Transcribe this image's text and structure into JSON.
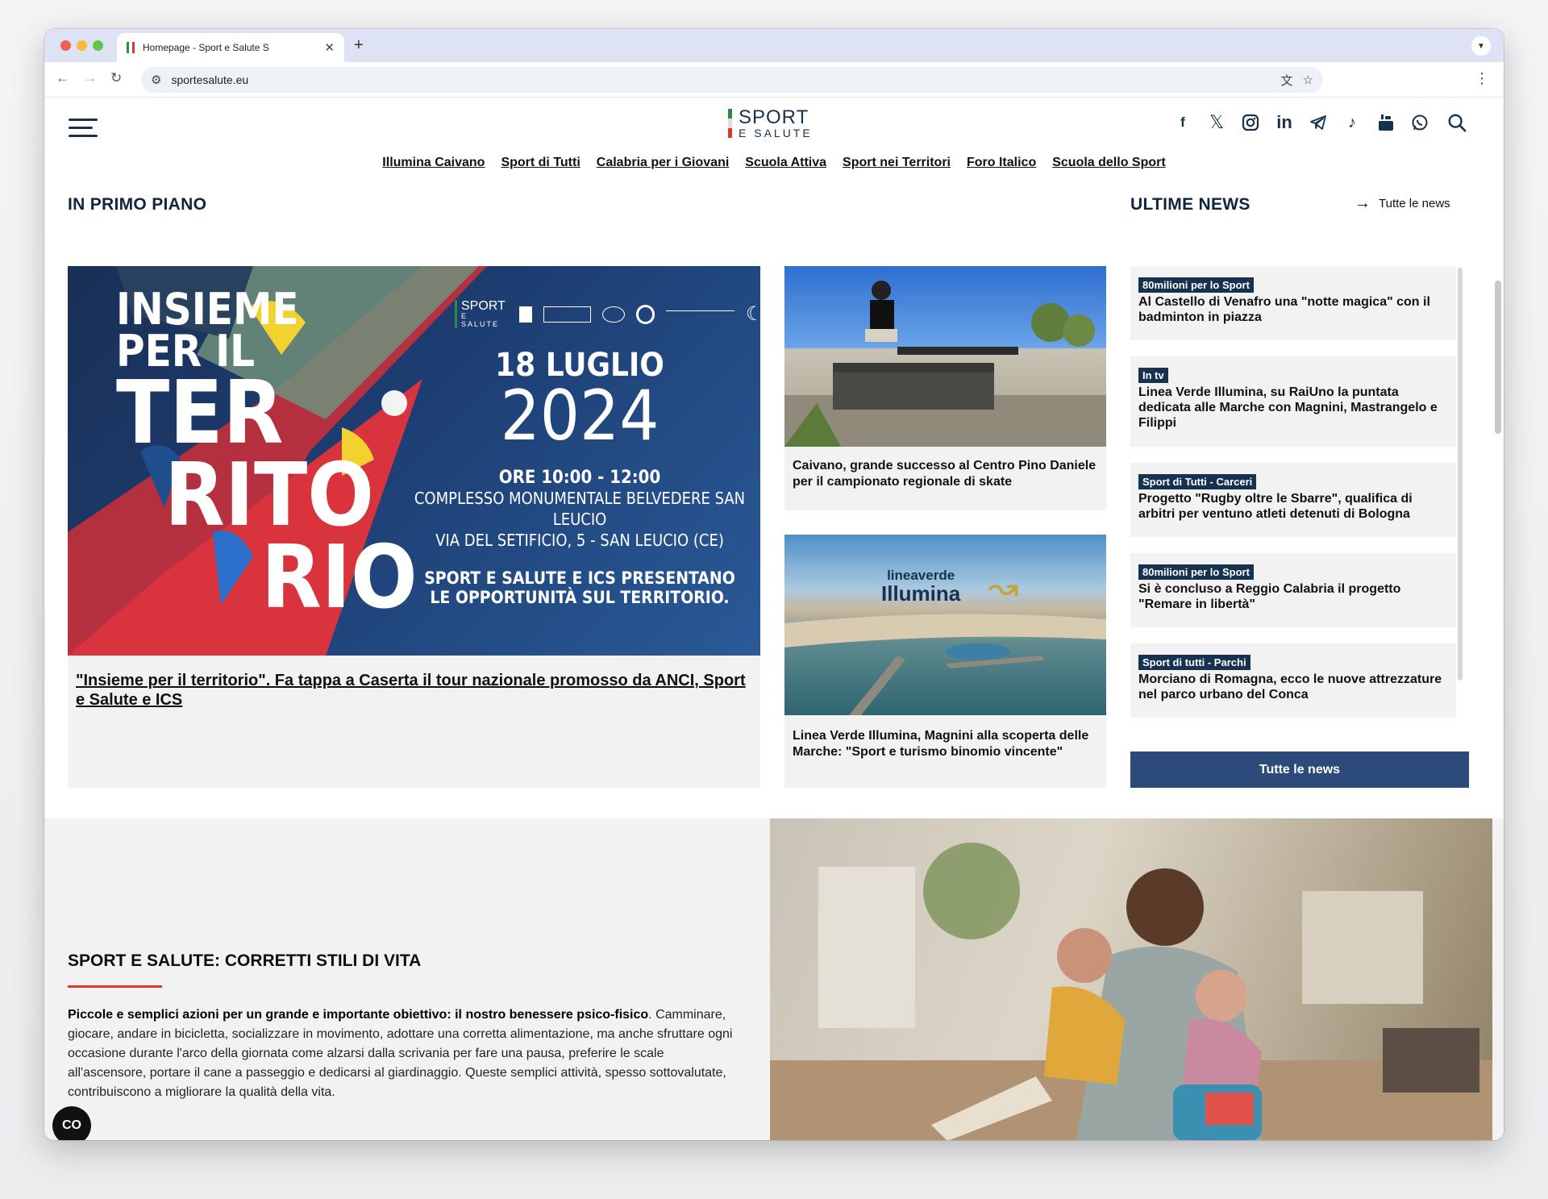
{
  "browser": {
    "tab_title": "Homepage - Sport e Salute S",
    "url": "sportesalute.eu"
  },
  "site": {
    "logo_line1": "SPORT",
    "logo_line2": "E SALUTE",
    "nav": [
      "Illumina Caivano",
      "Sport di Tutti",
      "Calabria per i Giovani",
      "Scuola Attiva",
      "Sport nei Territori",
      "Foro Italico",
      "Scuola dello Sport"
    ],
    "socials": [
      "facebook-icon",
      "x-icon",
      "instagram-icon",
      "linkedin-icon",
      "telegram-icon",
      "tiktok-icon",
      "youtube-icon",
      "whatsapp-icon"
    ]
  },
  "primo_piano": {
    "title": "IN PRIMO PIANO",
    "hero": {
      "caption": "\"Insieme per il territorio\". Fa tappa a Caserta il tour nazionale promosso da ANCI, Sport e Salute e ICS",
      "poster": {
        "headline_1": "INSIEME",
        "headline_2": "PER IL",
        "headline_3": "TER",
        "headline_4": "RITO",
        "headline_5": "RIO",
        "date": "18 LUGLIO",
        "year": "2024",
        "time": "ORE 10:00 - 12:00",
        "venue_1": "COMPLESSO MONUMENTALE BELVEDERE SAN LEUCIO",
        "venue_2": "VIA DEL SETIFICIO, 5 - SAN LEUCIO (CE)",
        "claim_1": "SPORT E SALUTE E ICS PRESENTANO",
        "claim_2": "LE OPPORTUNITÀ SUL TERRITORIO.",
        "logo_sport": "SPORT",
        "logo_salute": "E SALUTE"
      }
    },
    "cards": [
      {
        "caption": "Caivano, grande successo al Centro Pino Daniele per il campionato regionale di skate"
      },
      {
        "caption": "Linea Verde Illumina, Magnini alla scoperta delle Marche: \"Sport e turismo binomio vincente\"",
        "overlay_1": "lineaverde",
        "overlay_2": "Illumina"
      }
    ]
  },
  "news": {
    "title": "ULTIME NEWS",
    "all_link": "Tutte le news",
    "button": "Tutte le news",
    "items": [
      {
        "badge": "80milioni per lo Sport",
        "title": "Al Castello di Venafro una \"notte magica\" con il badminton in piazza"
      },
      {
        "badge": "In tv",
        "title": "Linea Verde Illumina, su RaiUno la puntata dedicata alle Marche con Magnini, Mastrangelo e Filippi"
      },
      {
        "badge": "Sport di Tutti - Carceri",
        "title": "Progetto \"Rugby oltre le Sbarre\", qualifica di arbitri per ventuno atleti detenuti di Bologna"
      },
      {
        "badge": "80milioni per lo Sport",
        "title": "Si è concluso a Reggio Calabria il progetto \"Remare in libertà\""
      },
      {
        "badge": "Sport di tutti - Parchi",
        "title": "Morciano di Romagna, ecco le nuove attrezzature nel parco urbano del Conca"
      }
    ]
  },
  "lifestyle": {
    "title": "SPORT E SALUTE: CORRETTI STILI DI VITA",
    "lead": "Piccole e semplici azioni per un grande e importante obiettivo: il nostro benessere psico-fisico",
    "body": ". Camminare, giocare, andare in bicicletta, socializzare in movimento, adottare una corretta alimentazione, ma anche sfruttare ogni occasione durante l'arco della giornata come alzarsi dalla scrivania per fare una pausa, preferire le scale all'ascensore, portare il cane a passeggio e dedicarsi al giardinaggio. Queste semplici attività, spesso sottovalutate, contribuiscono a migliorare la qualità della vita."
  },
  "colors": {
    "navy": "#173251",
    "button": "#2c4b7a",
    "accent_red": "#e03a2e"
  }
}
